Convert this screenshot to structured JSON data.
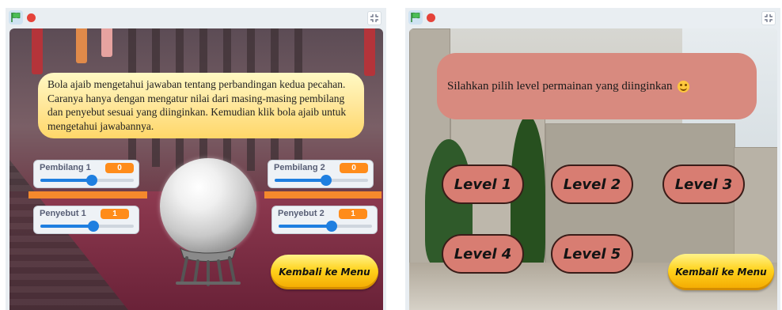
{
  "left_window": {
    "intro_text": "Bola ajaib mengetahui jawaban tentang perbandingan kedua pecahan. Caranya hanya dengan mengatur nilai dari masing-masing pembilang dan penyebut sesuai yang diinginkan. Kemudian klik bola ajaib untuk mengetahui jawabannya.",
    "sliders": [
      {
        "label": "Pembilang 1",
        "value": "0",
        "level_fraction": 0.55
      },
      {
        "label": "Penyebut 1",
        "value": "1",
        "level_fraction": 0.57
      },
      {
        "label": "Pembilang 2",
        "value": "0",
        "level_fraction": 0.55
      },
      {
        "label": "Penyebut 2",
        "value": "1",
        "level_fraction": 0.57
      }
    ],
    "menu_button": "Kembali ke Menu"
  },
  "right_window": {
    "prompt_text": "Silahkan pilih level permainan yang diinginkan",
    "levels": [
      "Level  1",
      "Level  2",
      "Level 3",
      "Level 4",
      "Level 5"
    ],
    "menu_button": "Kembali ke Menu"
  },
  "icons": {
    "green_flag": "green-flag-icon",
    "stop": "stop-icon",
    "fullscreen": "fullscreen-icon",
    "smiley": "smiley-icon"
  },
  "colors": {
    "flag_green": "#4cbf56",
    "stop_red": "#e5433a",
    "slider_value_orange": "#ff8c1a",
    "slider_blue": "#1f7fe0",
    "menu_yellow": "#ffd21c",
    "level_salmon": "#d87d72"
  }
}
